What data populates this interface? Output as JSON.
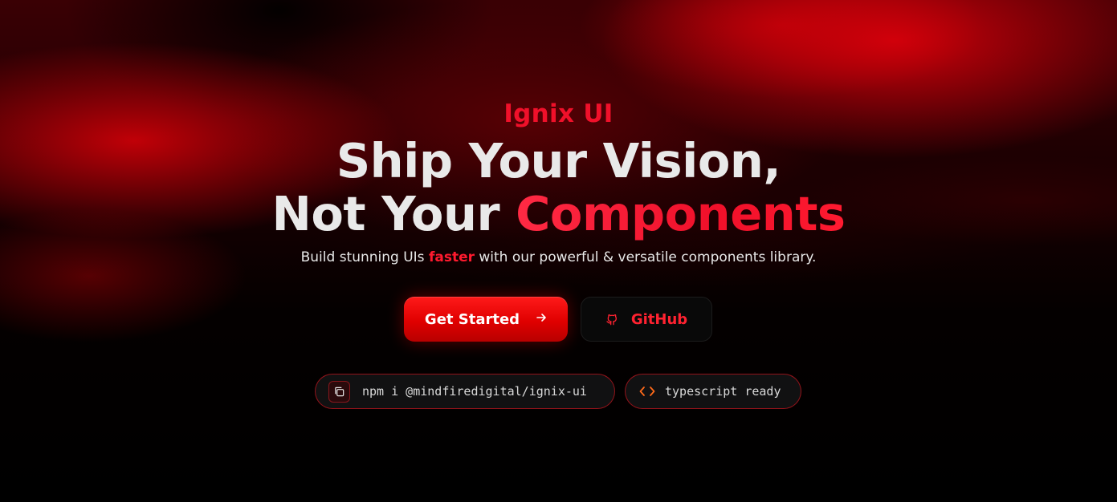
{
  "brand": {
    "name": "Ignix UI"
  },
  "hero": {
    "headline_line1": "Ship Your Vision,",
    "headline_line2_plain": "Not Your",
    "headline_line2_accent": "Components",
    "subtitle_before": "Build stunning UIs",
    "subtitle_highlight": "faster",
    "subtitle_after": "with our powerful & versatile components library."
  },
  "buttons": {
    "get_started_label": "Get Started",
    "get_started_icon": "arrow-right-icon",
    "github_label": "GitHub",
    "github_icon": "github-icon"
  },
  "pills": {
    "install_command": "npm i @mindfiredigital/ignix-ui",
    "install_icon": "copy-icon",
    "typescript_label": "typescript ready",
    "typescript_icon": "code-brackets-icon"
  },
  "colors": {
    "accent": "#f0102a",
    "primary_button": "#e00000",
    "background": "#000000",
    "text": "#e9e9e9",
    "code_icon": "#ff6a1a"
  }
}
